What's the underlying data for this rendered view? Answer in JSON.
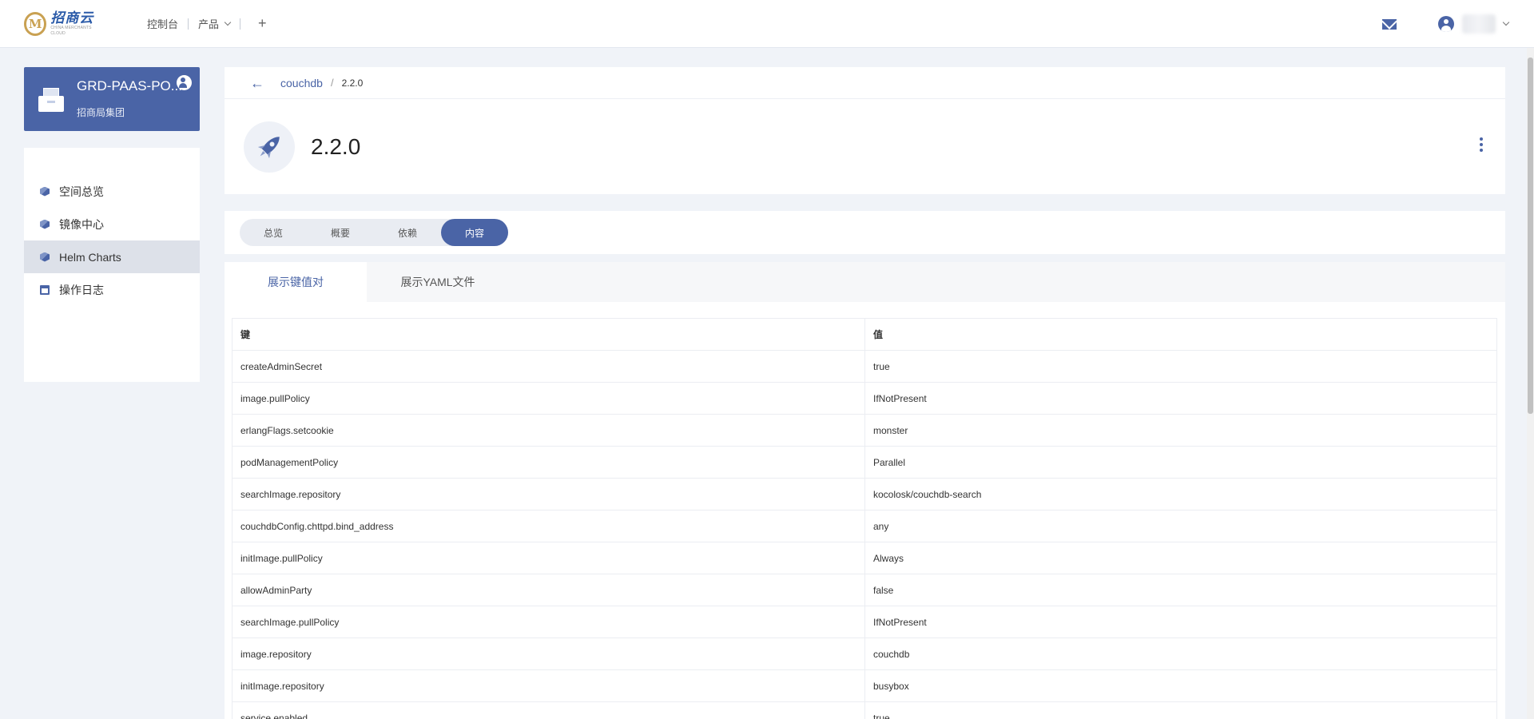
{
  "topnav": {
    "logo_text": "招商云",
    "logo_subtext": "CHINA MERCHANTS CLOUD",
    "links": [
      "控制台",
      "产品"
    ],
    "plus": "+"
  },
  "project": {
    "name": "GRD-PAAS-PO...",
    "org": "招商局集团"
  },
  "sidebar": {
    "items": [
      {
        "label": "空间总览",
        "icon": "cube-icon"
      },
      {
        "label": "镜像中心",
        "icon": "cube-icon"
      },
      {
        "label": "Helm Charts",
        "icon": "cube-icon",
        "active": true
      },
      {
        "label": "操作日志",
        "icon": "calendar-icon"
      }
    ]
  },
  "breadcrumb": {
    "back": "←",
    "parent": "couchdb",
    "separator": "/",
    "current": "2.2.0"
  },
  "header": {
    "title": "2.2.0"
  },
  "tabs": [
    "总览",
    "概要",
    "依赖",
    "内容"
  ],
  "active_tab": "内容",
  "subtabs": [
    "展示键值对",
    "展示YAML文件"
  ],
  "table": {
    "headers": [
      "键",
      "值"
    ],
    "rows": [
      [
        "createAdminSecret",
        "true"
      ],
      [
        "image.pullPolicy",
        "IfNotPresent"
      ],
      [
        "erlangFlags.setcookie",
        "monster"
      ],
      [
        "podManagementPolicy",
        "Parallel"
      ],
      [
        "searchImage.repository",
        "kocolosk/couchdb-search"
      ],
      [
        "couchdbConfig.chttpd.bind_address",
        "any"
      ],
      [
        "initImage.pullPolicy",
        "Always"
      ],
      [
        "allowAdminParty",
        "false"
      ],
      [
        "searchImage.pullPolicy",
        "IfNotPresent"
      ],
      [
        "image.repository",
        "couchdb"
      ],
      [
        "initImage.repository",
        "busybox"
      ],
      [
        "service.enabled",
        "true"
      ]
    ]
  },
  "colors": {
    "accent": "#4a64a6",
    "page_bg": "#f0f3f8"
  }
}
